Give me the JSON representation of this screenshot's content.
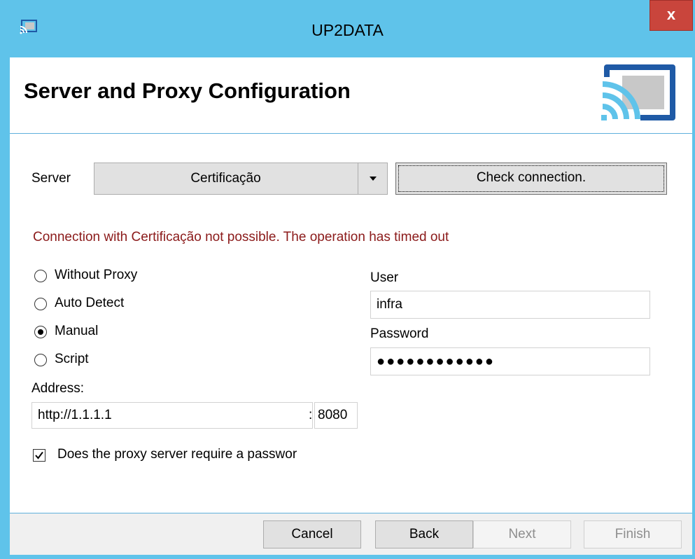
{
  "window": {
    "title": "UP2DATA",
    "close_label": "x"
  },
  "header": {
    "title": "Server and Proxy Configuration"
  },
  "server": {
    "label": "Server",
    "selected": "Certificação",
    "check_button": "Check connection."
  },
  "status": {
    "error": "Connection with Certificação not possible. The operation has timed out"
  },
  "proxy": {
    "options": [
      {
        "label": "Without Proxy",
        "checked": false
      },
      {
        "label": "Auto Detect",
        "checked": false
      },
      {
        "label": "Manual",
        "checked": true
      },
      {
        "label": "Script",
        "checked": false
      }
    ],
    "address_label": "Address:",
    "address_value": "http://1.1.1.1",
    "port_separator": ":",
    "port_value": "8080",
    "require_password_label": "Does the proxy server require a passwor",
    "require_password_checked": true
  },
  "credentials": {
    "user_label": "User",
    "user_value": "infra",
    "password_label": "Password",
    "password_value": "●●●●●●●●●●●●"
  },
  "footer": {
    "cancel": "Cancel",
    "back": "Back",
    "next": "Next",
    "finish": "Finish"
  },
  "colors": {
    "titlebar": "#5fc3ea",
    "close_button": "#c9453c",
    "error_text": "#8b1a1a",
    "logo_blue": "#1f5aa6",
    "accent_line": "#5fb0dc"
  }
}
